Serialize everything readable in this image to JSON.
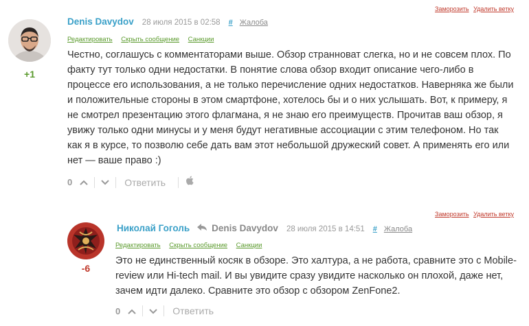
{
  "comments": [
    {
      "thread_actions": {
        "freeze": "Заморозить",
        "delete_branch": "Удалить ветку"
      },
      "author": "Denis Davydov",
      "date": "28 июля 2015 в 02:58",
      "hash": "#",
      "complaint": "Жалоба",
      "mod_links": {
        "edit": "Редактировать",
        "hide": "Скрыть сообщение",
        "sanctions": "Санкции"
      },
      "rating": "+1",
      "text": "Честно, соглашусь с комментаторами выше. Обзор странноват слегка, но и не совсем плох. По факту тут только одни недостатки. В понятие слова обзор входит описание чего-либо в процессе его использования, а не только перечисление одних недостатков. Наверняка же были и положительные стороны в этом смартфоне, хотелось бы и о них услышать. Вот, к примеру, я не смотрел презентацию этого флагмана, я не знаю его преимуществ. Прочитав ваш обзор, я увижу только одни минусы и у меня будут негативные ассоциации с этим телефоном. Но так как я в курсе, то позволю себе дать вам этот небольшой дружеский совет. А применять его или нет — ваше право :)",
      "score": "0",
      "reply_label": "Ответить",
      "platform_icon": "apple-icon"
    },
    {
      "thread_actions": {
        "freeze": "Заморозить",
        "delete_branch": "Удалить ветку"
      },
      "author": "Николай Гоголь",
      "reply_to": "Denis Davydov",
      "date": "28 июля 2015 в 14:51",
      "hash": "#",
      "complaint": "Жалоба",
      "mod_links": {
        "edit": "Редактировать",
        "hide": "Скрыть сообщение",
        "sanctions": "Санкции"
      },
      "rating": "-6",
      "text": "Это не единственный косяк в обзоре. Это халтура, а не работа, сравните это с Mobile-review или Hi-tech mail. И вы увидите сразу увидите насколько он плохой, даже нет, зачем идти далеко. Сравните это обзор с обзором ZenFone2.",
      "score": "0",
      "reply_label": "Ответить"
    }
  ],
  "colors": {
    "author": "#3aa0c8",
    "mod_links": "#5a9a2c",
    "thread_actions": "#c0392b",
    "rating_positive": "#5a9a2c",
    "rating_negative": "#c0392b"
  }
}
